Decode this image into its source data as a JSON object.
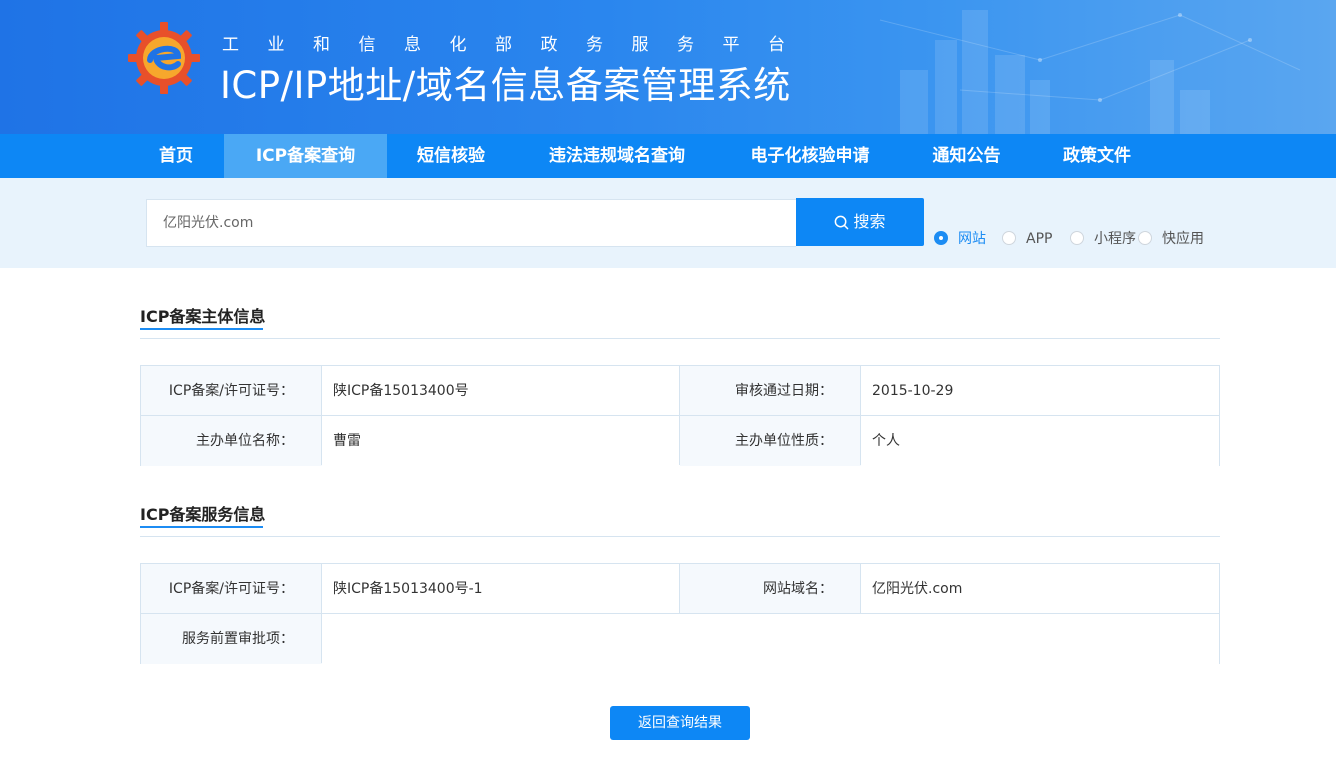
{
  "header": {
    "subtitle": "工业和信息化部政务服务平台",
    "title": "ICP/IP地址/域名信息备案管理系统"
  },
  "nav": {
    "items": [
      {
        "label": "首页"
      },
      {
        "label": "ICP备案查询",
        "active": true
      },
      {
        "label": "短信核验"
      },
      {
        "label": "违法违规域名查询"
      },
      {
        "label": "电子化核验申请"
      },
      {
        "label": "通知公告"
      },
      {
        "label": "政策文件"
      }
    ]
  },
  "search": {
    "value": "亿阳光伏.com",
    "button_label": "搜索",
    "options": [
      {
        "label": "网站",
        "selected": true
      },
      {
        "label": "APP",
        "selected": false
      },
      {
        "label": "小程序",
        "selected": false
      },
      {
        "label": "快应用",
        "selected": false
      }
    ]
  },
  "subject_info": {
    "title": "ICP备案主体信息",
    "rows": [
      {
        "label1": "ICP备案/许可证号：",
        "value1": "陕ICP备15013400号",
        "label2": "审核通过日期：",
        "value2": "2015-10-29"
      },
      {
        "label1": "主办单位名称：",
        "value1": "曹雷",
        "label2": "主办单位性质：",
        "value2": "个人"
      }
    ]
  },
  "service_info": {
    "title": "ICP备案服务信息",
    "row1": {
      "label1": "ICP备案/许可证号：",
      "value1": "陕ICP备15013400号-1",
      "label2": "网站域名：",
      "value2": "亿阳光伏.com"
    },
    "row2": {
      "label1": "服务前置审批项：",
      "value1": ""
    }
  },
  "back_button": "返回查询结果",
  "colors": {
    "primary": "#0d87f5",
    "nav_active": "#4aa8f5",
    "search_band": "#e8f3fc",
    "label_bg": "#f5f9fd",
    "border": "#d6e4f0"
  }
}
